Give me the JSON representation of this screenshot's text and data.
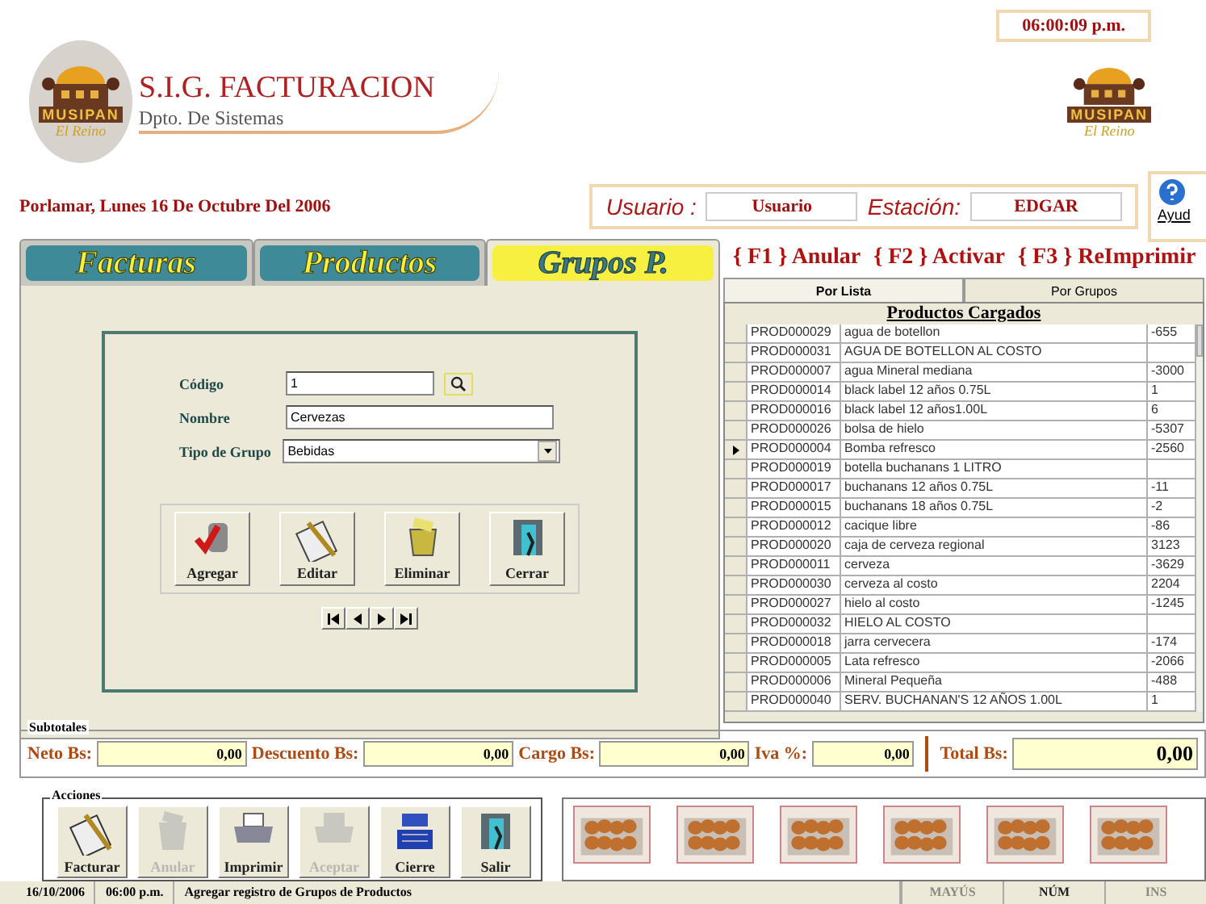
{
  "clock": "06:00:09 p.m.",
  "header": {
    "logo": {
      "name": "MUSIPAN",
      "tagline": "El Reino"
    },
    "title": "S.I.G. FACTURACION",
    "subtitle": "Dpto. De Sistemas",
    "logo_right": {
      "name": "MUSIPAN",
      "tagline": "El Reino"
    }
  },
  "date_line": "Porlamar, Lunes 16 De Octubre Del 2006",
  "session": {
    "user_label": "Usuario :",
    "user": "Usuario",
    "station_label": "Estación:",
    "station": "EDGAR"
  },
  "help_button": "Ayud",
  "tabs": [
    {
      "label": "Facturas",
      "selected": false
    },
    {
      "label": "Productos",
      "selected": false
    },
    {
      "label": "Grupos P.",
      "selected": true
    }
  ],
  "form": {
    "fields": [
      {
        "kind": "search",
        "label": "Código",
        "value": "1"
      },
      {
        "kind": "text",
        "label": "Nombre",
        "value": "Cervezas"
      },
      {
        "kind": "select",
        "label": "Tipo de Grupo",
        "value": "Bebidas"
      }
    ],
    "buttons": [
      {
        "kind": "add",
        "label": "Agregar"
      },
      {
        "kind": "edit",
        "label": "Editar"
      },
      {
        "kind": "delete",
        "label": "Eliminar"
      },
      {
        "kind": "exit",
        "label": "Cerrar"
      }
    ]
  },
  "function_keys": [
    "{ F1 } Anular",
    "{ F2 } Activar",
    "{ F3 } ReImprimir"
  ],
  "list_tabs": [
    {
      "label": "Por Lista",
      "selected": true
    },
    {
      "label": "Por Grupos",
      "selected": false
    }
  ],
  "table": {
    "title": "Productos Cargados",
    "rows": [
      {
        "code": "PROD000029",
        "name": "agua de  botellon",
        "stock": "-655",
        "selected": false
      },
      {
        "code": "PROD000031",
        "name": "AGUA DE BOTELLON AL COSTO",
        "stock": "",
        "selected": false
      },
      {
        "code": "PROD000007",
        "name": "agua Mineral mediana",
        "stock": "-3000",
        "selected": false
      },
      {
        "code": "PROD000014",
        "name": "black label 12 años 0.75L",
        "stock": "1",
        "selected": false
      },
      {
        "code": "PROD000016",
        "name": "black label 12 años1.00L",
        "stock": "6",
        "selected": false
      },
      {
        "code": "PROD000026",
        "name": "bolsa  de  hielo",
        "stock": "-5307",
        "selected": false
      },
      {
        "code": "PROD000004",
        "name": "Bomba refresco",
        "stock": "-2560",
        "selected": true
      },
      {
        "code": "PROD000019",
        "name": "botella buchanans 1 LITRO",
        "stock": "",
        "selected": false
      },
      {
        "code": "PROD000017",
        "name": "buchanans 12 años 0.75L",
        "stock": "-11",
        "selected": false
      },
      {
        "code": "PROD000015",
        "name": "buchanans 18 años 0.75L",
        "stock": "-2",
        "selected": false
      },
      {
        "code": "PROD000012",
        "name": "cacique libre",
        "stock": "-86",
        "selected": false
      },
      {
        "code": "PROD000020",
        "name": "caja  de  cerveza regional",
        "stock": "3123",
        "selected": false
      },
      {
        "code": "PROD000011",
        "name": "cerveza",
        "stock": "-3629",
        "selected": false
      },
      {
        "code": "PROD000030",
        "name": "cerveza  al costo",
        "stock": "2204",
        "selected": false
      },
      {
        "code": "PROD000027",
        "name": "hielo  al  costo",
        "stock": "-1245",
        "selected": false
      },
      {
        "code": "PROD000032",
        "name": "HIELO AL COSTO",
        "stock": "",
        "selected": false
      },
      {
        "code": "PROD000018",
        "name": "jarra  cervecera",
        "stock": "-174",
        "selected": false
      },
      {
        "code": "PROD000005",
        "name": "Lata refresco",
        "stock": "-2066",
        "selected": false
      },
      {
        "code": "PROD000006",
        "name": "Mineral Pequeña",
        "stock": "-488",
        "selected": false
      },
      {
        "code": "PROD000040",
        "name": "SERV. BUCHANAN'S 12 AÑOS 1.00L",
        "stock": "1",
        "selected": false
      }
    ]
  },
  "subtotals": {
    "title": "Subtotales",
    "fields": [
      {
        "label": "Neto Bs:",
        "value": "0,00"
      },
      {
        "label": "Descuento Bs:",
        "value": "0,00"
      },
      {
        "label": "Cargo Bs:",
        "value": "0,00"
      },
      {
        "label": "Iva %:",
        "value": "0,00"
      }
    ],
    "total": {
      "label": "Total Bs:",
      "value": "0,00"
    }
  },
  "actions": {
    "title": "Acciones",
    "buttons": [
      {
        "kind": "invoice",
        "label": "Facturar",
        "disabled": false
      },
      {
        "kind": "trash",
        "label": "Anular",
        "disabled": true
      },
      {
        "kind": "printer",
        "label": "Imprimir",
        "disabled": false
      },
      {
        "kind": "printer",
        "label": "Aceptar",
        "disabled": true
      },
      {
        "kind": "register",
        "label": "Cierre",
        "disabled": false
      },
      {
        "kind": "exit",
        "label": "Salir",
        "disabled": false
      }
    ]
  },
  "gallery": [
    {
      "kind": "picture"
    },
    {
      "kind": "picture"
    },
    {
      "kind": "picture"
    },
    {
      "kind": "picture"
    },
    {
      "kind": "picture"
    },
    {
      "kind": "picture"
    }
  ],
  "status_bar": {
    "date": "16/10/2006",
    "time": "06:00 p.m.",
    "message": "Agregar registro de Grupos de Productos",
    "indicators": [
      {
        "label": "MAYÚS",
        "on": false
      },
      {
        "label": "NÚM",
        "on": true
      },
      {
        "label": "INS",
        "on": false
      }
    ]
  }
}
